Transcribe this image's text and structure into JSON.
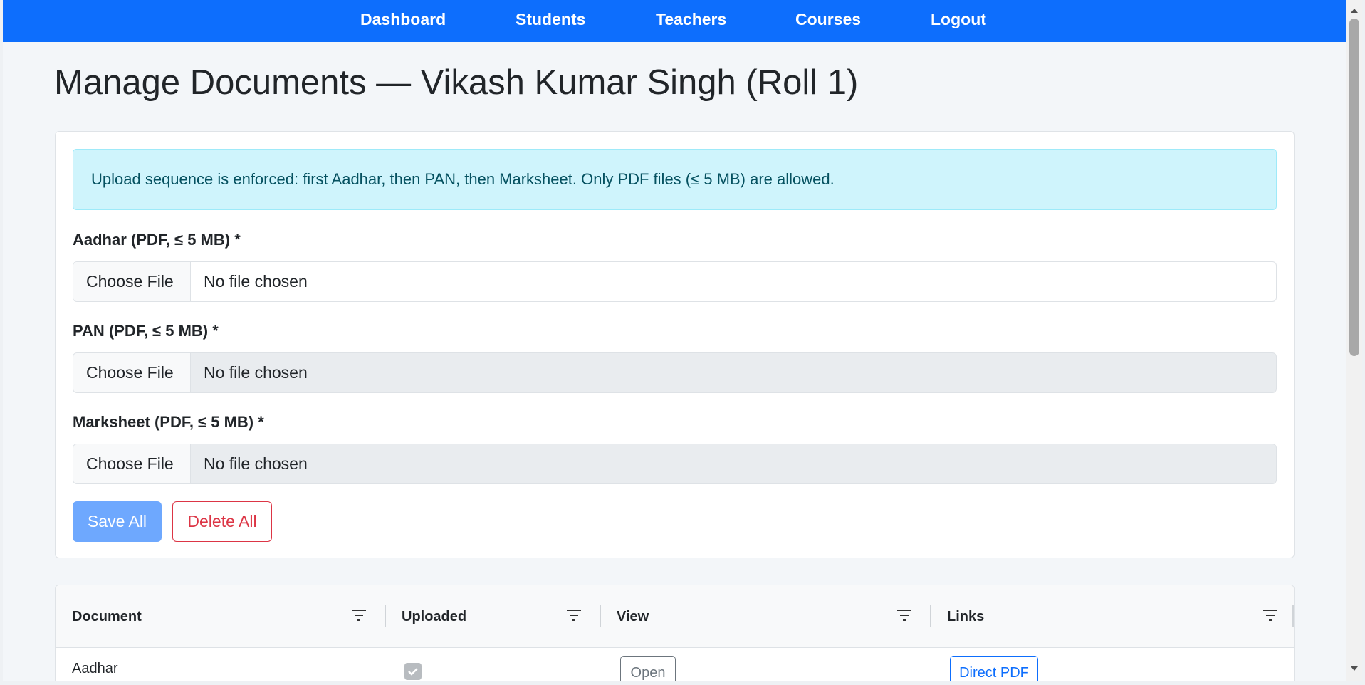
{
  "nav": {
    "items": [
      {
        "label": "Dashboard"
      },
      {
        "label": "Students"
      },
      {
        "label": "Teachers"
      },
      {
        "label": "Courses"
      },
      {
        "label": "Logout"
      }
    ]
  },
  "page": {
    "title": "Manage Documents — Vikash Kumar Singh (Roll 1)"
  },
  "upload_form": {
    "notice": "Upload sequence is enforced: first Aadhar, then PAN, then Marksheet. Only PDF files (≤ 5 MB) are allowed.",
    "fields": [
      {
        "label": "Aadhar (PDF, ≤ 5 MB) *",
        "button": "Choose File",
        "status": "No file chosen",
        "enabled": true
      },
      {
        "label": "PAN (PDF, ≤ 5 MB) *",
        "button": "Choose File",
        "status": "No file chosen",
        "enabled": false
      },
      {
        "label": "Marksheet (PDF, ≤ 5 MB) *",
        "button": "Choose File",
        "status": "No file chosen",
        "enabled": false
      }
    ],
    "save_label": "Save All",
    "delete_label": "Delete All"
  },
  "documents_table": {
    "columns": [
      "Document",
      "Uploaded",
      "View",
      "Links"
    ],
    "rows": [
      {
        "document": "Aadhar",
        "uploaded": true,
        "view": "Open",
        "links": "Direct PDF"
      }
    ]
  },
  "colors": {
    "nav_bg": "#0d6efd",
    "alert_bg": "#cff4fc",
    "save_button": "#6ea8fe",
    "delete_button": "#dc3545"
  },
  "icons": [
    "filter-icon",
    "check-icon",
    "scroll-up-arrow-icon",
    "scroll-down-arrow-icon"
  ]
}
